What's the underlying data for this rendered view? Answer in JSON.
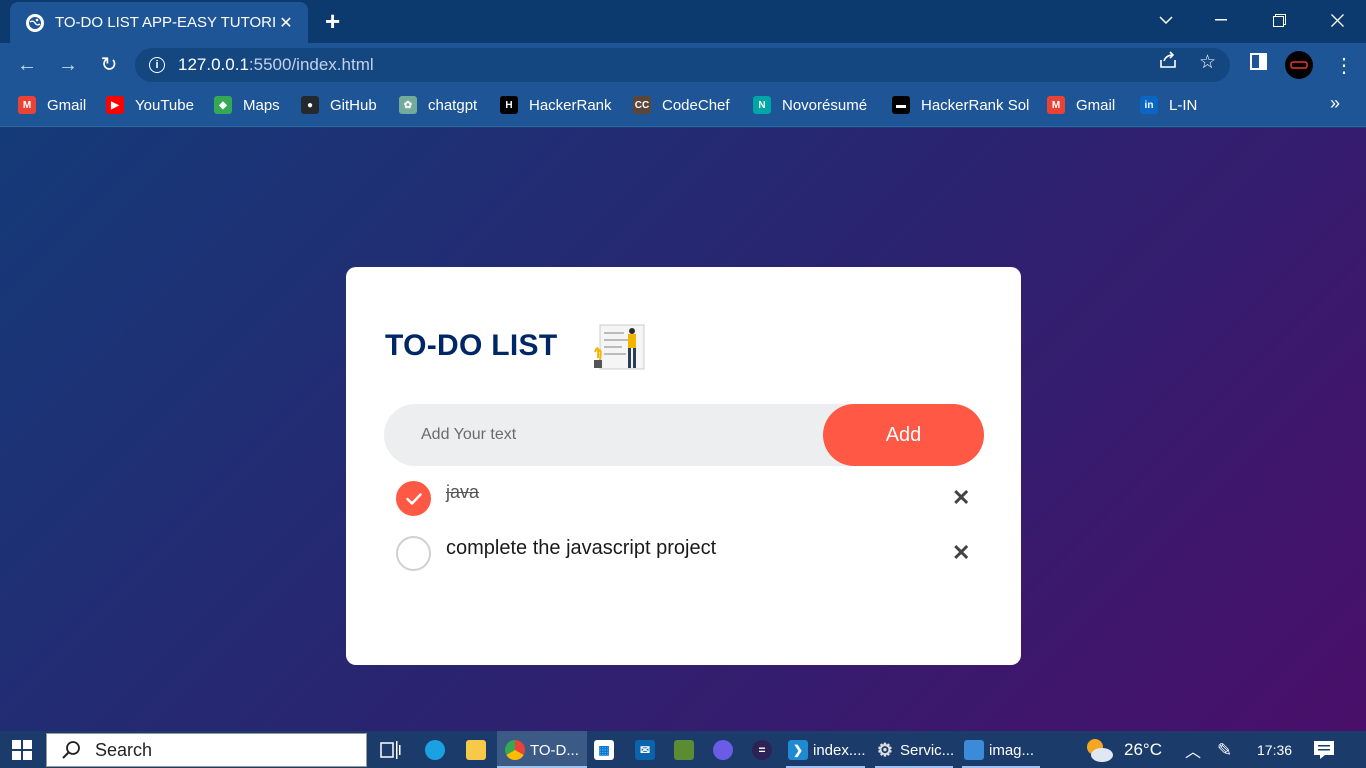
{
  "browser": {
    "tab_title": "TO-DO LIST APP-EASY TUTORIAL",
    "tab_close": "✕",
    "new_tab": "+",
    "url_host": "127.0.0.1",
    "url_path": ":5500/index.html",
    "bookmarks": [
      {
        "label": "Gmail",
        "icon": "gmail-icon",
        "color": "#ea4335",
        "glyph": "M"
      },
      {
        "label": "YouTube",
        "icon": "youtube-icon",
        "color": "#ff0000",
        "glyph": "▶"
      },
      {
        "label": "Maps",
        "icon": "maps-icon",
        "color": "#34a853",
        "glyph": "◆"
      },
      {
        "label": "GitHub",
        "icon": "github-icon",
        "color": "#24292e",
        "glyph": "●"
      },
      {
        "label": "chatgpt",
        "icon": "chatgpt-icon",
        "color": "#74aa9c",
        "glyph": "✿"
      },
      {
        "label": "HackerRank",
        "icon": "hackerrank-icon",
        "color": "#000000",
        "glyph": "H"
      },
      {
        "label": "CodeChef",
        "icon": "codechef-icon",
        "color": "#5b4638",
        "glyph": "CC"
      },
      {
        "label": "Novorésumé",
        "icon": "novoresume-icon",
        "color": "#00a6a6",
        "glyph": "N"
      },
      {
        "label": "HackerRank Sol",
        "icon": "hackerrank-sol-icon",
        "color": "#000000",
        "glyph": "▬"
      },
      {
        "label": "Gmail",
        "icon": "gmail-icon",
        "color": "#ea4335",
        "glyph": "M"
      },
      {
        "label": "L-IN",
        "icon": "linkedin-icon",
        "color": "#0a66c2",
        "glyph": "in"
      }
    ],
    "bookmarks_more": "»"
  },
  "app": {
    "title": "TO-DO LIST",
    "input_placeholder": "Add Your text",
    "add_label": "Add",
    "accent_color": "#ff5945",
    "title_color": "#002765",
    "tasks": [
      {
        "text": "java",
        "checked": true
      },
      {
        "text": "complete the javascript project",
        "checked": false
      }
    ],
    "delete_glyph": "✕"
  },
  "taskbar": {
    "search_label": "Search",
    "apps": [
      {
        "label": "TO-D...",
        "icon": "chrome-icon"
      },
      {
        "label": "index....",
        "icon": "vscode-icon"
      },
      {
        "label": "Servic...",
        "icon": "services-icon"
      },
      {
        "label": "imag...",
        "icon": "photos-icon"
      }
    ],
    "temperature": "26°C",
    "time": "17:36"
  }
}
